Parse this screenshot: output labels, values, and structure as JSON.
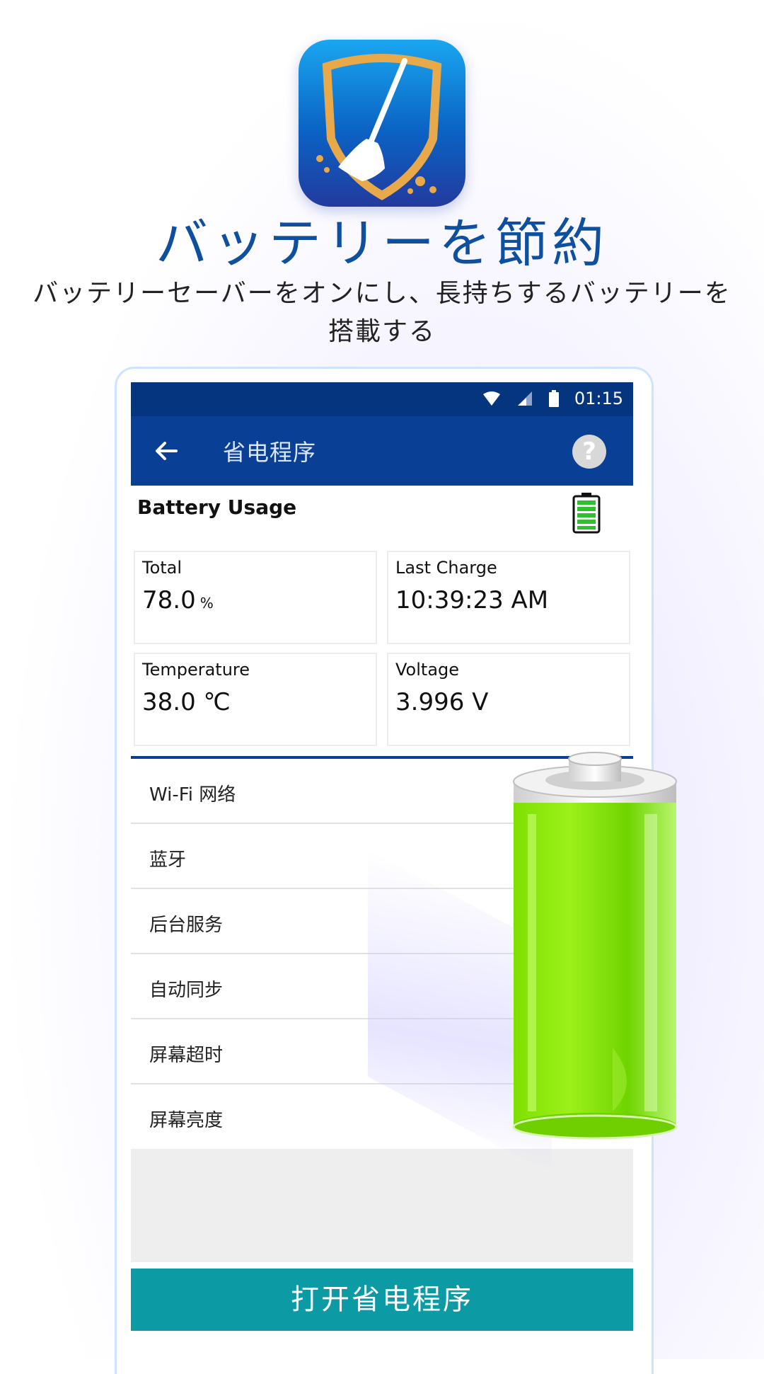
{
  "promo": {
    "headline": "バッテリーを節約",
    "subtitle": "バッテリーセーバーをオンにし、長持ちするバッテリーを搭載する"
  },
  "status_bar": {
    "time": "01:15"
  },
  "toolbar": {
    "title": "省电程序",
    "help_label": "?"
  },
  "battery_usage": {
    "title": "Battery Usage",
    "cards": [
      {
        "label": "Total",
        "value": "78.0",
        "unit": "%"
      },
      {
        "label": "Last Charge",
        "value": "10:39:23 AM",
        "unit": ""
      },
      {
        "label": "Temperature",
        "value": "38.0 ℃",
        "unit": ""
      },
      {
        "label": "Voltage",
        "value": "3.996 V",
        "unit": ""
      }
    ]
  },
  "settings_list": [
    {
      "label": "Wi-Fi 网络"
    },
    {
      "label": "蓝牙"
    },
    {
      "label": "后台服务"
    },
    {
      "label": "自动同步"
    },
    {
      "label": "屏幕超时"
    },
    {
      "label": "屏幕亮度"
    }
  ],
  "action_button": {
    "label": "打开省电程序"
  },
  "colors": {
    "headline": "#0e4fa0",
    "status_bar": "#06357f",
    "toolbar": "#0a3f96",
    "action_button": "#0c9aa4",
    "battery_green": "#7fe000"
  },
  "icons": [
    "shield-broom-app-icon",
    "wifi-icon",
    "signal-icon",
    "battery-status-icon",
    "back-arrow-icon",
    "help-icon",
    "battery-level-icon",
    "battery-cylinder-illustration"
  ]
}
